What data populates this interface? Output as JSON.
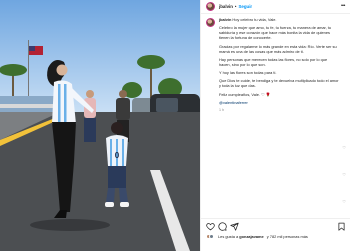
{
  "header": {
    "username": "jbalvin",
    "separator": "•",
    "follow_label": "Seguir",
    "more_label": "•••"
  },
  "caption": {
    "username": "jbalvin",
    "intro": "Hoy celebro tu vida, Vale.",
    "para1": "Celebro la mujer que amo, tu fe, tu fuerza, tu manera de amar, tu sabiduría y ese corazón que hace más bonita la vida de quienes tienen la fortuna de conocerte.",
    "para2": "Gracias por regalarme lo más grande en esta vida: Río. Verte ser su mamá es una de las cosas que más admiro de ti.",
    "para3": "Hay personas que merecen todas las flores, no solo por lo que hacen, sino por lo que son.",
    "para4": "Y hoy las flores son todas para ti.",
    "para5": "Que Dios te cuide, te bendiga y te devuelva multiplicado todo el amor y toda la luz que das.",
    "para6": "Feliz cumpleaños, Vale. ♡ 🌹",
    "mention": "@valentinaferrer",
    "time": "1 h"
  },
  "footer": {
    "likes_prefix": "Les gusta a",
    "likes_user": "gonzajavame",
    "likes_suffix": "y 782 mil personas más"
  },
  "colors": {
    "accent": "#0095f6",
    "text": "#262626",
    "muted": "#8e8e8e",
    "border": "#efefef"
  },
  "icons": [
    "heart-icon",
    "comment-icon",
    "share-icon",
    "bookmark-icon",
    "more-icon"
  ]
}
